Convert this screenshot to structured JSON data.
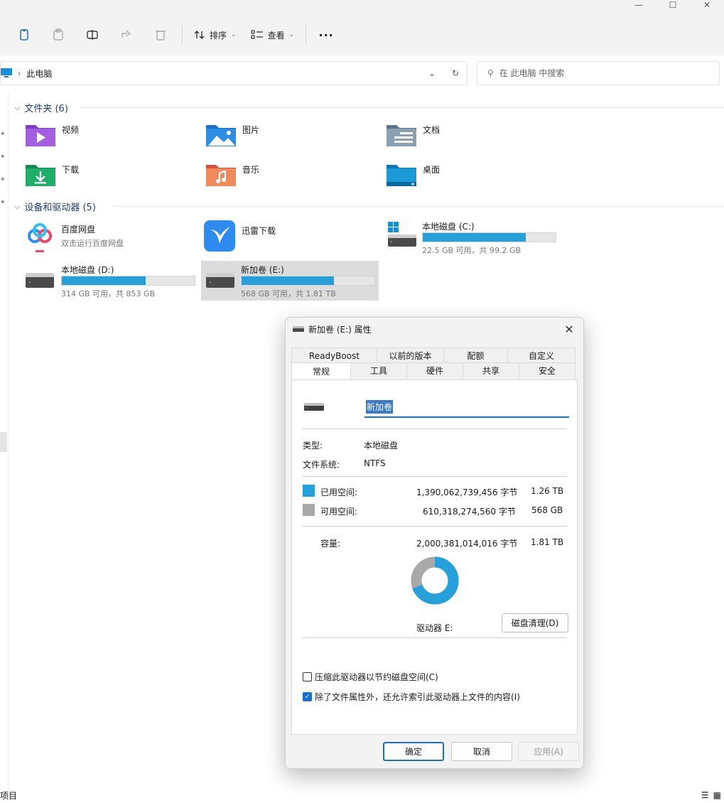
{
  "window": {
    "minimize": "—",
    "maximize": "☐",
    "close": "✕"
  },
  "toolbar": {
    "sort_label": "排序",
    "view_label": "查看",
    "more_label": "···"
  },
  "address": {
    "path": "此电脑",
    "search_placeholder": "在 此电脑 中搜索"
  },
  "folders_section": {
    "title": "文件夹 (6)",
    "items": [
      {
        "label": "视频"
      },
      {
        "label": "图片"
      },
      {
        "label": "文档"
      },
      {
        "label": "下载"
      },
      {
        "label": "音乐"
      },
      {
        "label": "桌面"
      }
    ]
  },
  "drives_section": {
    "title": "设备和驱动器 (5)",
    "items": [
      {
        "name": "百度网盘",
        "sub": "双击运行百度网盘"
      },
      {
        "name": "迅雷下载",
        "sub": ""
      },
      {
        "name": "本地磁盘 (C:)",
        "sub": "22.5 GB 可用，共 99.2 GB",
        "used_fraction": 0.773
      },
      {
        "name": "本地磁盘 (D:)",
        "sub": "314 GB 可用，共 853 GB",
        "used_fraction": 0.632
      },
      {
        "name": "新加卷 (E:)",
        "sub": "568 GB 可用，共 1.81 TB",
        "used_fraction": 0.695
      }
    ]
  },
  "status": {
    "count": "项目",
    "list_view": "☰",
    "tile_view": "▦"
  },
  "dialog": {
    "title": "新加卷 (E:) 属性",
    "tabs_top": [
      "ReadyBoost",
      "以前的版本",
      "配额",
      "自定义"
    ],
    "tabs_bottom": [
      "常规",
      "工具",
      "硬件",
      "共享",
      "安全"
    ],
    "volume_name": "新加卷",
    "type_label": "类型:",
    "type_value": "本地磁盘",
    "fs_label": "文件系统:",
    "fs_value": "NTFS",
    "used_label": "已用空间:",
    "used_bytes": "1,390,062,739,456 字节",
    "used_size": "1.26 TB",
    "free_label": "可用空间:",
    "free_bytes": "610,318,274,560 字节",
    "free_size": "568 GB",
    "capacity_label": "容量:",
    "capacity_bytes": "2,000,381,014,016 字节",
    "capacity_size": "1.81 TB",
    "used_fraction": 0.695,
    "used_color": "#26a0da",
    "free_color": "#a9a9a9",
    "drive_label": "驱动器 E:",
    "cleanup_button": "磁盘清理(D)",
    "compress_label": "压缩此驱动器以节约磁盘空间(C)",
    "compress_checked": false,
    "index_label": "除了文件属性外，还允许索引此驱动器上文件的内容(I)",
    "index_checked": true,
    "ok": "确定",
    "cancel": "取消",
    "apply": "应用(A)"
  }
}
